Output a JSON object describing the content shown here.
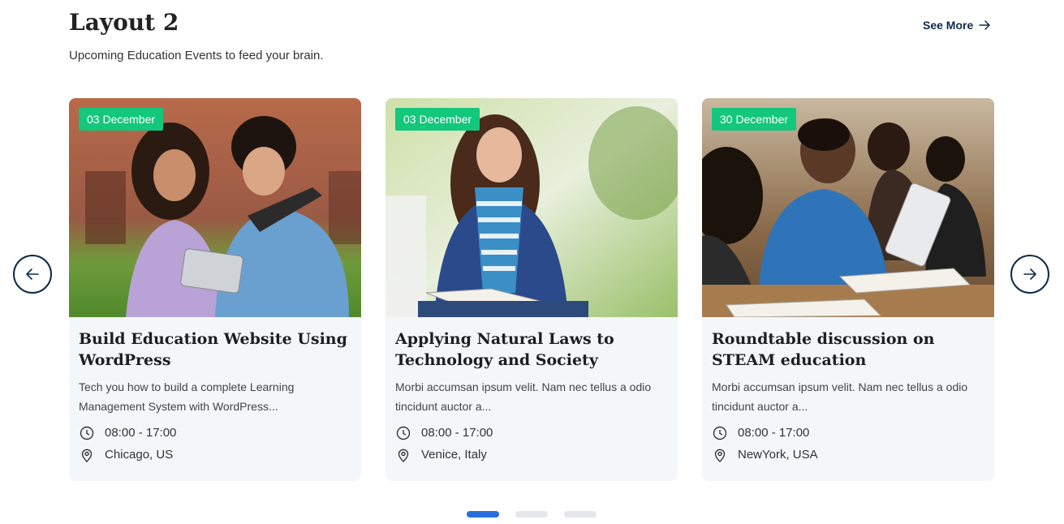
{
  "header": {
    "title": "Layout 2",
    "subtitle": "Upcoming Education Events to feed your brain.",
    "see_more": "See More"
  },
  "colors": {
    "accent_green": "#13c77d",
    "navy": "#0f2a47",
    "active_dot": "#2a6fdb",
    "card_bg": "#f5f6f8"
  },
  "carousel": {
    "pages": 3,
    "active_page": 1,
    "prev_icon": "arrow-left-icon",
    "next_icon": "arrow-right-icon"
  },
  "events": [
    {
      "date": "03 December",
      "title": "Build Education Website Using WordPress",
      "description": "Tech you how to build a complete Learning Management System with WordPress...",
      "time": "08:00 - 17:00",
      "location": "Chicago, US"
    },
    {
      "date": "03 December",
      "title": "Applying Natural Laws to Technology and Society",
      "description": "Morbi accumsan ipsum velit. Nam nec tellus a odio tincidunt auctor a...",
      "time": "08:00 - 17:00",
      "location": "Venice, Italy"
    },
    {
      "date": "30 December",
      "title": "Roundtable discussion on STEAM education",
      "description": "Morbi accumsan ipsum velit. Nam nec tellus a odio tincidunt auctor a...",
      "time": "08:00 - 17:00",
      "location": "NewYork, USA"
    }
  ]
}
